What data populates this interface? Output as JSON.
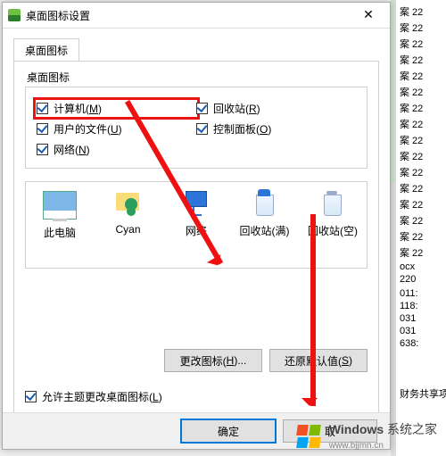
{
  "window": {
    "title": "桌面图标设置"
  },
  "tab": {
    "label": "桌面图标"
  },
  "group": {
    "label": "桌面图标"
  },
  "checks": {
    "computer": {
      "label_pre": "计算机(",
      "mnemonic": "M",
      "label_post": ")",
      "checked": true
    },
    "recycle": {
      "label_pre": "回收站(",
      "mnemonic": "R",
      "label_post": ")",
      "checked": true
    },
    "userfiles": {
      "label_pre": "用户的文件(",
      "mnemonic": "U",
      "label_post": ")",
      "checked": true
    },
    "control": {
      "label_pre": "控制面板(",
      "mnemonic": "O",
      "label_post": ")",
      "checked": true
    },
    "network": {
      "label_pre": "网络(",
      "mnemonic": "N",
      "label_post": ")",
      "checked": true
    }
  },
  "icons": {
    "pc": "此电脑",
    "user": "Cyan",
    "net": "网络",
    "binfull": "回收站(满)",
    "binempty": "回收站(空)"
  },
  "buttons": {
    "change_icon_pre": "更改图标(",
    "change_icon_m": "H",
    "change_icon_post": ")...",
    "restore_pre": "还原默认值(",
    "restore_m": "S",
    "restore_post": ")"
  },
  "allow_theme": {
    "label_pre": "允许主题更改桌面图标(",
    "mnemonic": "L",
    "label_post": ")",
    "checked": true
  },
  "dlg": {
    "ok": "确定",
    "cancel_partial": "取"
  },
  "bg": {
    "rows": [
      "案 22",
      "案 22",
      "案 22",
      "案 22",
      "案 22",
      "案 22",
      "案 22",
      "案 22",
      "案 22",
      "案 22",
      "案 22",
      "案 22",
      "案 22",
      "案 22",
      "案 22",
      "案 22",
      "ocx",
      "220",
      "",
      "011:",
      "118:",
      "031",
      "031",
      "638:"
    ],
    "bottom": "财务共享项目"
  },
  "watermark": {
    "brand": "Windows",
    "suffix": "系统之家",
    "url": "www.bjjmn.cn"
  }
}
